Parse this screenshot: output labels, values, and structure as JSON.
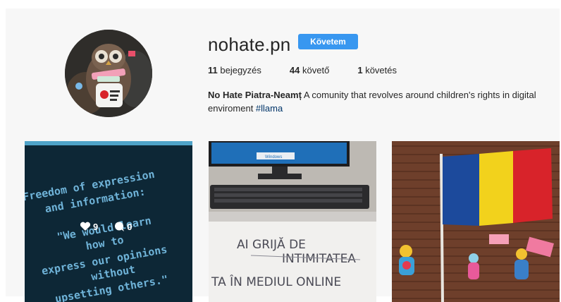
{
  "profile": {
    "username": "nohate.pn",
    "follow_label": "Követem",
    "stats": {
      "posts_count": "11",
      "posts_label": "bejegyzés",
      "followers_count": "44",
      "followers_label": "követő",
      "following_count": "1",
      "following_label": "követés"
    },
    "bio": {
      "name": "No Hate Piatra-Neamț",
      "text": " A comunity that revolves around children's rights in digital enviroment ",
      "hashtag": "#llama"
    }
  },
  "posts": [
    {
      "lines": [
        "Freedom of expression",
        "and information:",
        "\"We would learn",
        "how to",
        "express our opinions",
        "without",
        "upsetting others.\""
      ],
      "likes": "9",
      "comments": "0",
      "overlay_visible": true
    },
    {
      "paper_lines": [
        "AI GRIJĂ DE",
        "INTIMITATEA",
        "TA ÎN MEDIUL ONLINE"
      ],
      "screen_text": "Windows"
    },
    {
      "subject": "romanian-flag-with-clay-figures"
    }
  ],
  "colors": {
    "follow_button": "#3897f0",
    "hashtag": "#003569",
    "flag_blue": "#1c4a9c",
    "flag_yellow": "#f2d21c",
    "flag_red": "#d8232a"
  }
}
